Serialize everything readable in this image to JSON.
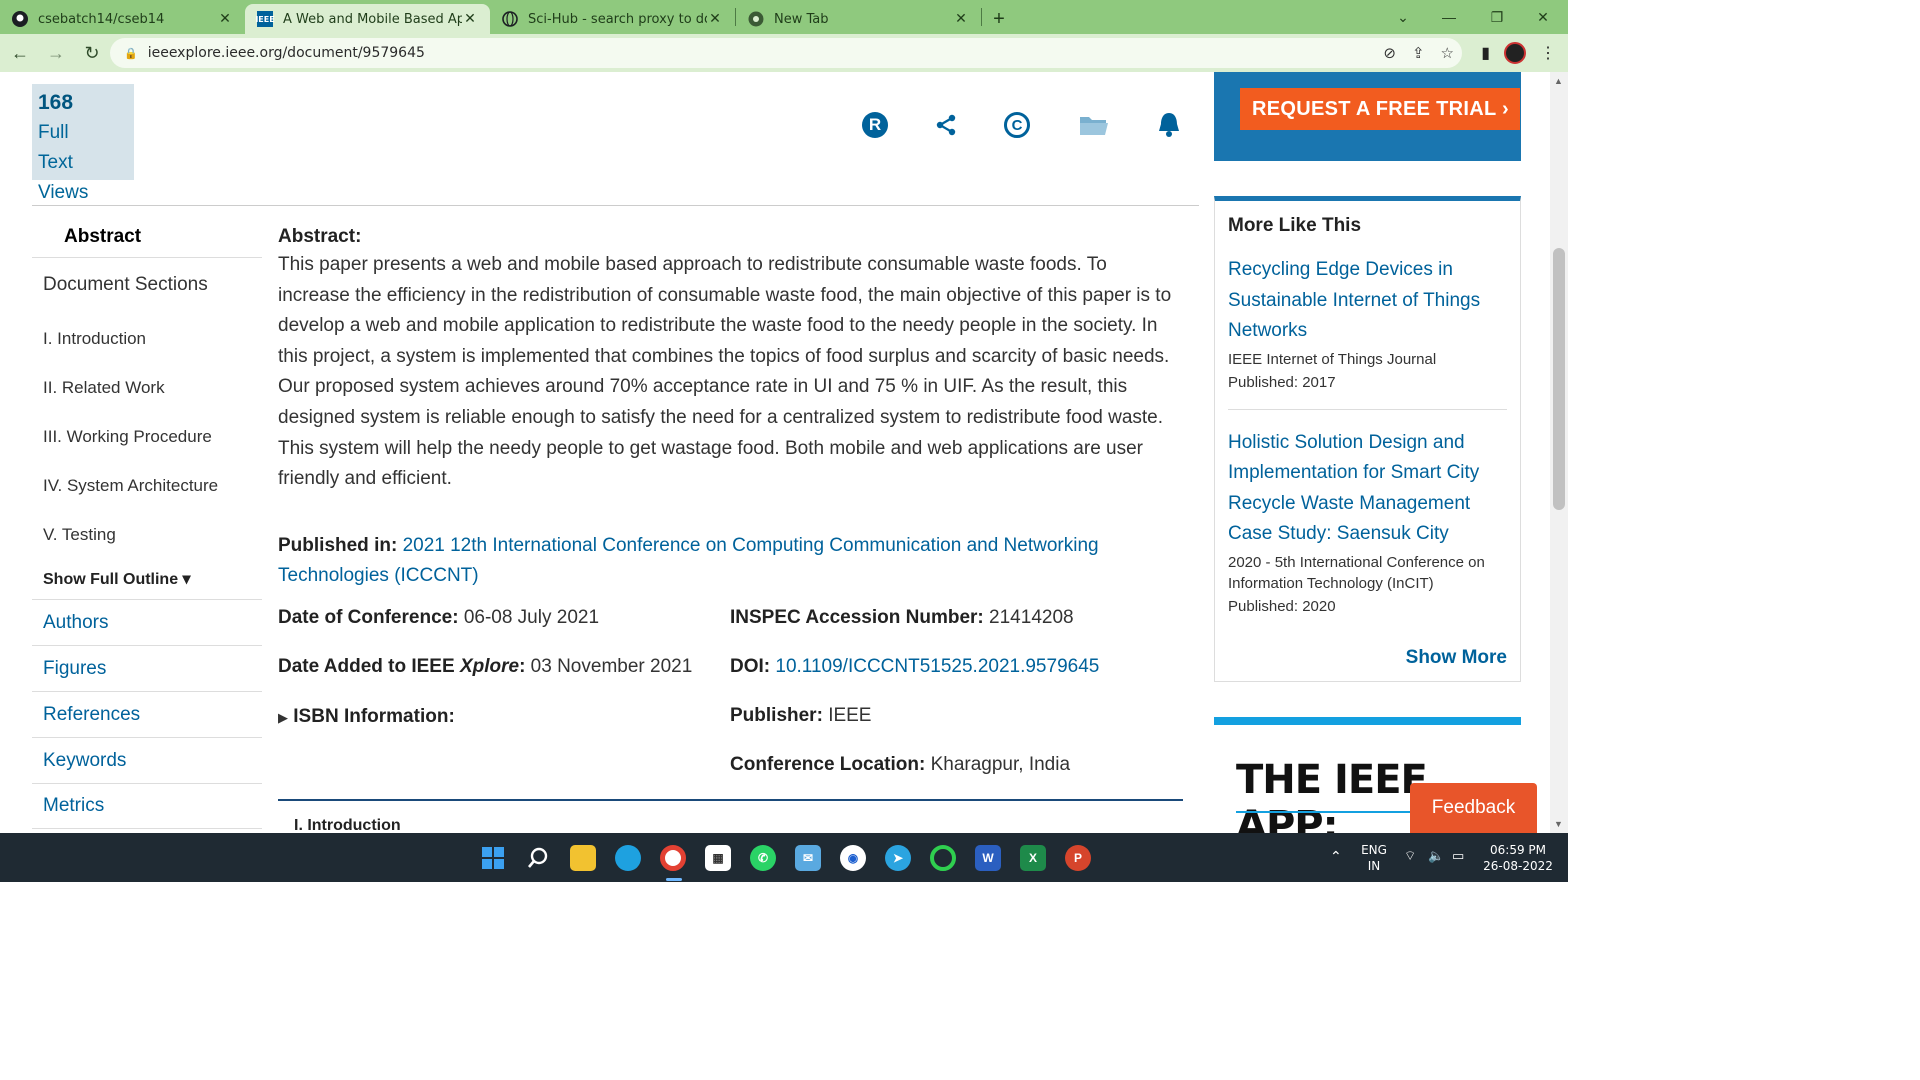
{
  "browser": {
    "tabs": [
      {
        "title": "csebatch14/cseb14",
        "icon": "github-icon"
      },
      {
        "title": "A Web and Mobile Based Approach",
        "icon": "ieee-icon"
      },
      {
        "title": "Sci-Hub - search proxy to download",
        "icon": "globe-icon"
      },
      {
        "title": "New Tab",
        "icon": "chrome-icon"
      }
    ],
    "url": "ieeexplore.ieee.org/document/9579645"
  },
  "metrics": {
    "count": "168",
    "line1": "Full",
    "line2": "Text Views"
  },
  "ad_top": {
    "button": "REQUEST A FREE TRIAL ›"
  },
  "leftnav": {
    "abstract": "Abstract",
    "doc_sections": "Document Sections",
    "sections": [
      "I.  Introduction",
      "II.  Related Work",
      "III.  Working Procedure",
      "IV.  System Architecture",
      "V.  Testing"
    ],
    "show_outline": "Show Full Outline ▾",
    "links": [
      "Authors",
      "Figures",
      "References",
      "Keywords",
      "Metrics"
    ]
  },
  "abstract": {
    "label": "Abstract:",
    "text": "This paper presents a web and mobile based approach to redistribute consumable waste foods. To increase the efficiency in the redistribution of consumable waste food, the main objective of this paper is to develop a web and mobile application to redistribute the waste food to the needy people in the society. In this project, a system is implemented that combines the topics of food surplus and scarcity of basic needs. Our proposed system achieves around 70% acceptance rate in UI and 75 % in UIF. As the result, this designed system is reliable enough to satisfy the need for a centralized system to redistribute food waste. This system will help the needy people to get wastage food. Both mobile and web applications are user friendly and efficient."
  },
  "published_in": {
    "label": "Published in:",
    "value": "2021 12th International Conference on Computing Communication and Networking Technologies (ICCCNT)"
  },
  "meta": {
    "date_conf_label": "Date of Conference:",
    "date_conf": "06-08 July 2021",
    "date_added_label_a": "Date Added to IEEE ",
    "date_added_label_b": "Xplore",
    "date_added": "03 November 2021",
    "isbn": "ISBN Information:",
    "inspec_label": "INSPEC Accession Number:",
    "inspec": "21414208",
    "doi_label": "DOI:",
    "doi": "10.1109/ICCCNT51525.2021.9579645",
    "publisher_label": "Publisher:",
    "publisher": "IEEE",
    "location_label": "Conference Location:",
    "location": "Kharagpur, India"
  },
  "intro_peek": "I. Introduction",
  "more_like_this": {
    "title": "More Like This",
    "items": [
      {
        "title": "Recycling Edge Devices in Sustainable Internet of Things Networks",
        "source": "IEEE Internet of Things Journal",
        "published": "Published: 2017"
      },
      {
        "title": "Holistic Solution Design and Implementation for Smart City Recycle Waste Management Case Study: Saensuk City",
        "source": "2020 - 5th International Conference on Information Technology (InCIT)",
        "published": "Published: 2020"
      }
    ],
    "show_more": "Show More"
  },
  "ad_bottom": {
    "headline": "THE IEEE APP:"
  },
  "feedback": "Feedback",
  "taskbar": {
    "lang1": "ENG",
    "lang2": "IN",
    "time": "06:59 PM",
    "date": "26-08-2022"
  }
}
